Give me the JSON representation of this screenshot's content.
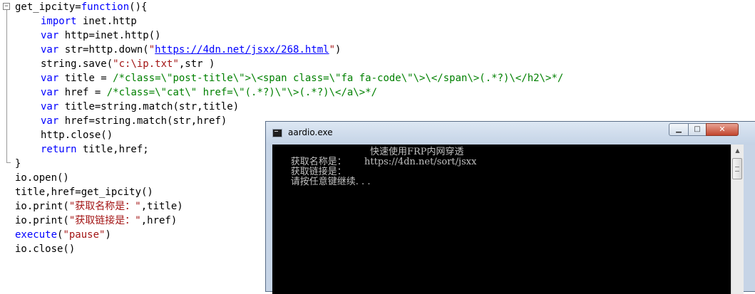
{
  "editor": {
    "fold_marker": "−",
    "lines": [
      {
        "indent": false,
        "parts": [
          {
            "c": "",
            "t": "get_ipcity="
          },
          {
            "c": "kw",
            "t": "function"
          },
          {
            "c": "",
            "t": "(){"
          }
        ]
      },
      {
        "indent": true,
        "parts": [
          {
            "c": "kw",
            "t": "import"
          },
          {
            "c": "",
            "t": " inet.http"
          }
        ]
      },
      {
        "indent": true,
        "parts": [
          {
            "c": "kw",
            "t": "var"
          },
          {
            "c": "",
            "t": " http=inet.http()"
          }
        ]
      },
      {
        "indent": true,
        "parts": [
          {
            "c": "kw",
            "t": "var"
          },
          {
            "c": "",
            "t": " str=http.down("
          },
          {
            "c": "str",
            "t": "\""
          },
          {
            "c": "lnk",
            "t": "https://4dn.net/jsxx/268.html"
          },
          {
            "c": "str",
            "t": "\""
          },
          {
            "c": "",
            "t": ")"
          }
        ]
      },
      {
        "indent": true,
        "parts": [
          {
            "c": "",
            "t": "string.save("
          },
          {
            "c": "str",
            "t": "\"c:\\ip.txt\""
          },
          {
            "c": "",
            "t": ",str )"
          }
        ]
      },
      {
        "indent": true,
        "parts": [
          {
            "c": "kw",
            "t": "var"
          },
          {
            "c": "",
            "t": " title = "
          },
          {
            "c": "cm",
            "t": "/*class=\\\"post-title\\\">\\<span class=\\\"fa fa-code\\\"\\>\\</span\\>(.*?)\\</h2\\>*/"
          }
        ]
      },
      {
        "indent": true,
        "parts": [
          {
            "c": "kw",
            "t": "var"
          },
          {
            "c": "",
            "t": " href = "
          },
          {
            "c": "cm",
            "t": "/*class=\\\"cat\\\" href=\\\"(.*?)\\\"\\>(.*?)\\</a\\>*/"
          }
        ]
      },
      {
        "indent": true,
        "parts": [
          {
            "c": "kw",
            "t": "var"
          },
          {
            "c": "",
            "t": " title=string.match(str,title)"
          }
        ]
      },
      {
        "indent": true,
        "parts": [
          {
            "c": "kw",
            "t": "var"
          },
          {
            "c": "",
            "t": " href=string.match(str,href)"
          }
        ]
      },
      {
        "indent": true,
        "parts": [
          {
            "c": "",
            "t": "http.close()"
          }
        ]
      },
      {
        "indent": true,
        "parts": [
          {
            "c": "kw",
            "t": "return"
          },
          {
            "c": "",
            "t": " title,href;"
          }
        ]
      },
      {
        "indent": false,
        "parts": [
          {
            "c": "",
            "t": "}"
          }
        ]
      },
      {
        "indent": false,
        "parts": [
          {
            "c": "",
            "t": "io.open()"
          }
        ]
      },
      {
        "indent": false,
        "parts": [
          {
            "c": "",
            "t": "title,href=get_ipcity()"
          }
        ]
      },
      {
        "indent": false,
        "parts": [
          {
            "c": "",
            "t": "io.print("
          },
          {
            "c": "str",
            "t": "\"获取名称是：\""
          },
          {
            "c": "",
            "t": ",title)"
          }
        ]
      },
      {
        "indent": false,
        "parts": [
          {
            "c": "",
            "t": "io.print("
          },
          {
            "c": "str",
            "t": "\"获取链接是：\""
          },
          {
            "c": "",
            "t": ",href)"
          }
        ]
      },
      {
        "indent": false,
        "parts": [
          {
            "c": "kw",
            "t": "execute"
          },
          {
            "c": "",
            "t": "("
          },
          {
            "c": "str",
            "t": "\"pause\""
          },
          {
            "c": "",
            "t": ")"
          }
        ]
      },
      {
        "indent": false,
        "parts": [
          {
            "c": "",
            "t": "io.close()"
          }
        ]
      }
    ]
  },
  "console": {
    "title": "aardio.exe",
    "minimize_label": "▁",
    "maximize_label": "□",
    "close_label": "✕",
    "scroll_up": "▲",
    "lines": [
      {
        "label": "获取名称是：",
        "value": "快速使用FRP内网穿透"
      },
      {
        "label": "获取链接是：",
        "value": "https://4dn.net/sort/jsxx"
      },
      {
        "label": "请按任意键继续. . .",
        "value": ""
      }
    ]
  },
  "colors": {
    "keyword": "#0000ff",
    "string": "#a31515",
    "comment": "#008000",
    "console_bg": "#000000",
    "console_text": "#c0c0c0"
  }
}
